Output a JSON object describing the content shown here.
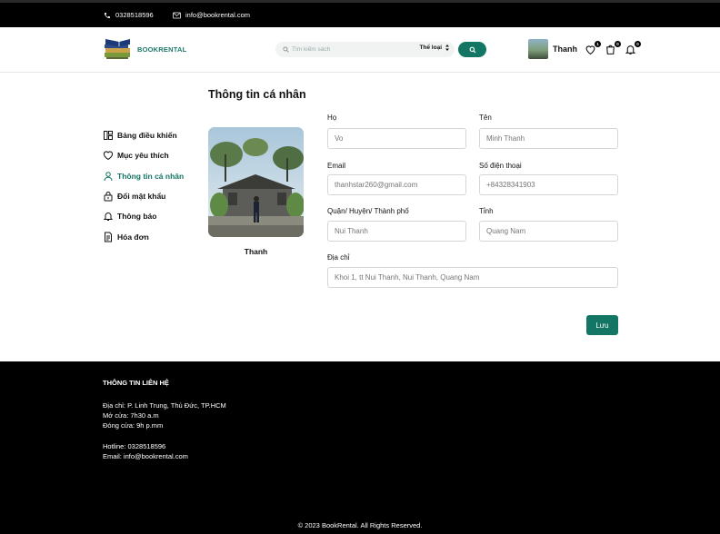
{
  "topbar": {
    "phone": "0328518596",
    "email": "info@bookrental.com"
  },
  "header": {
    "logo_text": "BOOKRENTAL",
    "search_placeholder": "Tìm kiếm sách",
    "category_label": "Thể loại",
    "user_name": "Thanh",
    "wishlist_count": "1",
    "cart_count": "0",
    "notification_count": "0"
  },
  "page": {
    "title": "Thông tin cá nhân"
  },
  "sidebar": {
    "items": [
      {
        "label": "Bảng điều khiển",
        "icon": "dashboard-icon"
      },
      {
        "label": "Mục yêu thích",
        "icon": "heart-icon"
      },
      {
        "label": "Thông tin cá nhân",
        "icon": "user-icon",
        "active": true
      },
      {
        "label": "Đổi mật khẩu",
        "icon": "lock-icon"
      },
      {
        "label": "Thông báo",
        "icon": "bell-icon"
      },
      {
        "label": "Hóa đơn",
        "icon": "invoice-icon"
      }
    ]
  },
  "profile": {
    "name": "Thanh"
  },
  "form": {
    "last_name": {
      "label": "Họ",
      "placeholder": "Vo"
    },
    "first_name": {
      "label": "Tên",
      "placeholder": "Minh Thanh"
    },
    "email": {
      "label": "Email",
      "placeholder": "thanhstar260@gmail.com"
    },
    "phone": {
      "label": "Số điện thoại",
      "placeholder": "+84328341903"
    },
    "district": {
      "label": "Quận/ Huyện/ Thành phố",
      "placeholder": "Nui Thanh"
    },
    "province": {
      "label": "Tỉnh",
      "placeholder": "Quang Nam"
    },
    "address": {
      "label": "Địa chỉ",
      "placeholder": "Khoi 1, tt Nui Thanh, Nui Thanh, Quang Nam"
    },
    "save_label": "Lưu"
  },
  "footer": {
    "title": "THÔNG TIN LIÊN HỆ",
    "address": "Địa chỉ: P. Linh Trung, Thủ Đức, TP.HCM",
    "open": "Mở cửa: 7h30 a.m",
    "close": "Đóng cửa: 9h p.mm",
    "hotline": "Hotline: 0328518596",
    "email": "Email: info@bookrental.com",
    "copyright": "© 2023 BookRental. All Rights Reserved."
  },
  "colors": {
    "accent": "#137563",
    "background": "#ffffff",
    "footer": "#000000"
  }
}
